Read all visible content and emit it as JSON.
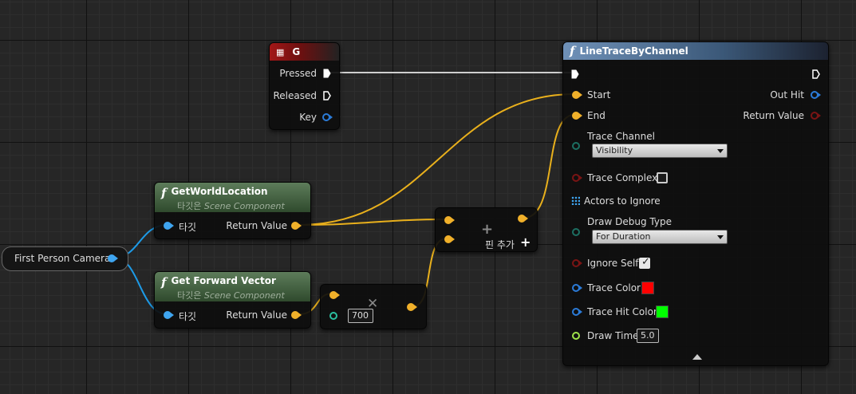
{
  "key_node": {
    "title": "G",
    "pins": {
      "pressed": "Pressed",
      "released": "Released",
      "key": "Key"
    }
  },
  "line_trace": {
    "title": "LineTraceByChannel",
    "pins": {
      "start": "Start",
      "end": "End",
      "out_hit": "Out Hit",
      "return_value": "Return Value",
      "trace_channel": "Trace Channel",
      "trace_complex": "Trace Complex",
      "actors_to_ignore": "Actors to Ignore",
      "draw_debug_type": "Draw Debug Type",
      "ignore_self": "Ignore Self",
      "trace_color": "Trace Color",
      "trace_hit_color": "Trace Hit Color",
      "draw_time": "Draw Time"
    },
    "values": {
      "trace_channel": "Visibility",
      "draw_debug_type": "For Duration",
      "draw_time": "5.0",
      "trace_complex": false,
      "ignore_self": true,
      "trace_color": "#ff0000",
      "trace_hit_color": "#00ff00"
    }
  },
  "get_world_location": {
    "title": "GetWorldLocation",
    "subtitle_prefix": "타깃은",
    "subtitle": "Scene Component",
    "target": "타깃",
    "return_value": "Return Value"
  },
  "get_forward_vector": {
    "title": "Get Forward Vector",
    "subtitle_prefix": "타깃은",
    "subtitle": "Scene Component",
    "target": "타깃",
    "return_value": "Return Value"
  },
  "camera_node": {
    "label": "First Person Camera"
  },
  "add_node": {
    "add_pin": "핀 추가"
  },
  "multiply_node": {
    "value": "700"
  },
  "colors": {
    "exec_wire": "#dddddd",
    "vector_wire": "#e9b01c",
    "object_wire": "#1d9ae6"
  },
  "icons": {
    "function": "function-icon",
    "keyboard": "keyboard-icon",
    "add": "plus-icon",
    "multiply": "multiply-icon",
    "collapse": "collapse-arrow-icon"
  }
}
